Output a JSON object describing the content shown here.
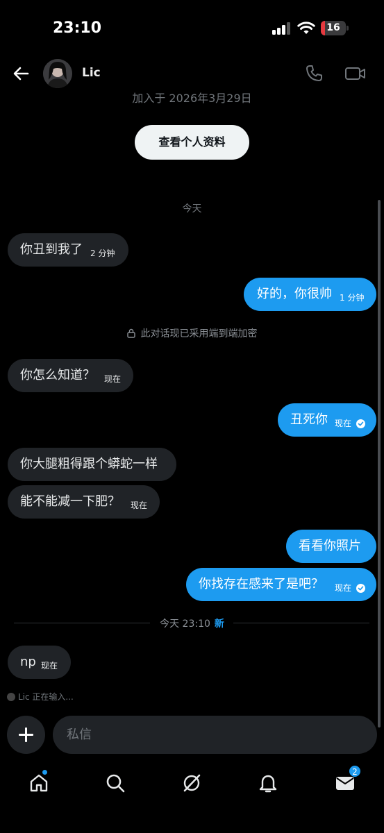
{
  "status_bar": {
    "time": "23:10",
    "battery_level": "16",
    "battery_fraction": 0.16
  },
  "header": {
    "contact_name": "Lic"
  },
  "conversation": {
    "joined_text": "加入于 2026年3月29日",
    "view_profile_label": "查看个人资料",
    "day_label": "今天",
    "encryption_notice": "此对话现已采用端到端加密",
    "new_divider_time": "今天 23:10",
    "new_divider_tag": "新",
    "messages": [
      {
        "text": "你丑到我了",
        "time": "2 分钟"
      },
      {
        "text": "好的，你很帅",
        "time": "1 分钟"
      },
      {
        "text": "你怎么知道？",
        "time": "现在"
      },
      {
        "text": "丑死你",
        "time": "现在"
      },
      {
        "text": "你大腿粗得跟个蟒蛇一样",
        "time": ""
      },
      {
        "text": "能不能减一下肥？",
        "time": "现在"
      },
      {
        "text": "看看你照片",
        "time": ""
      },
      {
        "text": "你找存在感来了是吧？",
        "time": "现在"
      },
      {
        "text": "np",
        "time": "现在"
      }
    ],
    "typing_indicator": "Lic 正在输入..."
  },
  "composer": {
    "placeholder": "私信"
  },
  "tabbar": {
    "messages_badge": "2"
  },
  "colors": {
    "accent": "#1d9bf0",
    "incoming_bubble": "#202327",
    "background": "#000000",
    "battery_low": "#e5393f"
  }
}
